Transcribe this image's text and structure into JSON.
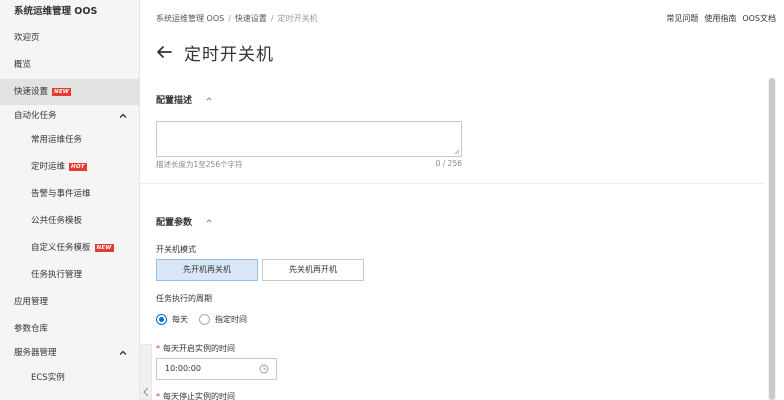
{
  "sidebar": {
    "title": "系统运维管理 OOS",
    "items": [
      {
        "label": "欢迎页"
      },
      {
        "label": "概览"
      },
      {
        "label": "快速设置",
        "badge": "NEW"
      },
      {
        "label": "自动化任务"
      },
      {
        "label": "常用运维任务"
      },
      {
        "label": "定时运维",
        "badge": "HOT"
      },
      {
        "label": "告警与事件运维"
      },
      {
        "label": "公共任务模板"
      },
      {
        "label": "自定义任务模板",
        "badge": "NEW"
      },
      {
        "label": "任务执行管理"
      },
      {
        "label": "应用管理"
      },
      {
        "label": "参数仓库"
      },
      {
        "label": "服务器管理"
      },
      {
        "label": "ECS实例"
      }
    ]
  },
  "breadcrumb": {
    "items": [
      "系统运维管理 OOS",
      "快速设置",
      "定时开关机"
    ],
    "separator": "/"
  },
  "top_links": [
    "常见问题",
    "使用指南",
    "OOS文档"
  ],
  "page_title": "定时开关机",
  "config_desc": {
    "title": "配置描述",
    "textarea_value": "",
    "hint": "描述长度为1至256个字符",
    "counter": "0 / 256"
  },
  "config_params": {
    "title": "配置参数",
    "mode_label": "开关机模式",
    "mode_options": [
      "先开机再关机",
      "先关机再开机"
    ],
    "mode_selected": "先开机再关机",
    "period_label": "任务执行的周期",
    "period_options": [
      "每天",
      "指定时间"
    ],
    "period_selected": "每天",
    "start_time_label": "每天开启实例的时间",
    "start_time_value": "10:00:00",
    "stop_time_label": "每天停止实例的时间",
    "required_mark": "*"
  },
  "colors": {
    "accent": "#0070cc",
    "selected_bg": "#d8e8f7",
    "badge_red": "#e53a2f",
    "sidebar_bg": "#f5f5f5",
    "active_item_bg": "#e2e2e2"
  }
}
